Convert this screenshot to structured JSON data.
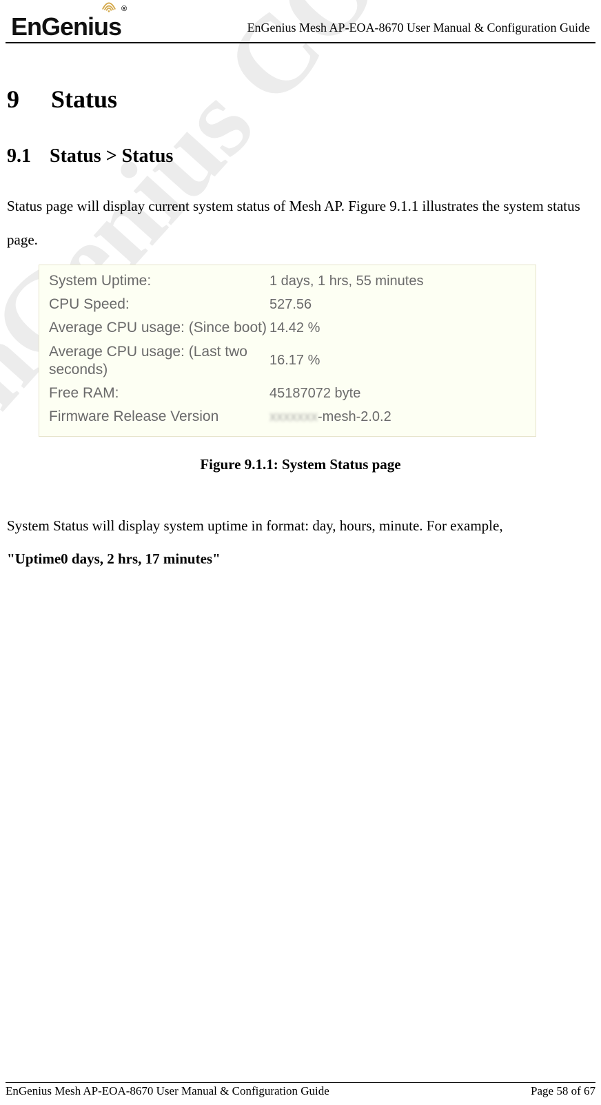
{
  "header": {
    "logo_text_1": "EnGen",
    "logo_text_2": "i",
    "logo_text_3": "us",
    "logo_reg": "®",
    "title": "EnGenius Mesh AP-EOA-8670 User Manual & Configuration Guide"
  },
  "watermark_text": "EnGenius CONFIDENTIAL",
  "section": {
    "h1_num": "9",
    "h1_text": "Status",
    "h2_num": "9.1",
    "h2_text": "Status > Status",
    "para1": "Status page will display current system status of Mesh AP. Figure 9.1.1 illustrates the system status page.",
    "caption": "Figure 9.1.1: System Status page",
    "para2_a": "System Status will display system uptime in format: day, hours, minute. For example,",
    "para2_b": "\"Uptime0 days, 2 hrs, 17 minutes\""
  },
  "figure": {
    "rows": [
      {
        "label": "System Uptime:",
        "value": "1 days, 1 hrs, 55 minutes"
      },
      {
        "label": "CPU Speed:",
        "value": "527.56"
      },
      {
        "label": "Average CPU usage: (Since boot)",
        "value": "14.42 %"
      },
      {
        "label": "Average CPU usage: (Last two seconds)",
        "value": "16.17 %"
      },
      {
        "label": "Free RAM:",
        "value": "45187072 byte"
      }
    ],
    "last_row_label": "Firmware Release Version",
    "last_row_prefix_blur": "xxxxxxx",
    "last_row_suffix": "-mesh-2.0.2"
  },
  "footer": {
    "left": "EnGenius Mesh AP-EOA-8670 User Manual & Configuration Guide",
    "right": "Page 58 of 67"
  }
}
